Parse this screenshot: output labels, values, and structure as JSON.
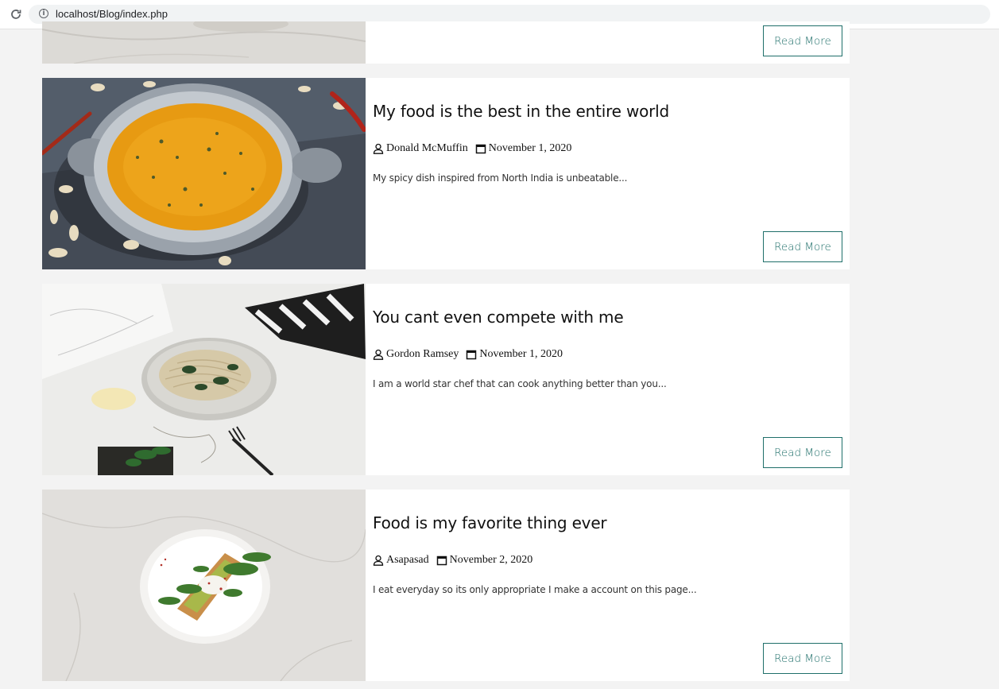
{
  "browser": {
    "url": "localhost/Blog/index.php"
  },
  "posts": [
    {
      "title": "",
      "author": "",
      "date": "",
      "excerpt": "",
      "read_more_label": "Read More"
    },
    {
      "title": "My food is the best in the entire world",
      "author": "Donald McMuffin",
      "date": "November 1, 2020",
      "excerpt": "My spicy dish inspired from North India is unbeatable...",
      "read_more_label": "Read More"
    },
    {
      "title": "You cant even compete with me",
      "author": "Gordon Ramsey",
      "date": "November 1, 2020",
      "excerpt": "I am a world star chef that can cook anything better than you...",
      "read_more_label": "Read More"
    },
    {
      "title": "Food is my favorite thing ever",
      "author": "Asapasad",
      "date": "November 2, 2020",
      "excerpt": "I eat everyday so its only appropriate I make a account on this page...",
      "read_more_label": "Read More"
    }
  ],
  "colors": {
    "accent": "#1f6f6a",
    "page_background": "#f3f3f3",
    "card_background": "#ffffff"
  },
  "icons": {
    "author": "user-icon",
    "date": "calendar-icon",
    "reload": "reload-icon",
    "info": "info-icon"
  }
}
